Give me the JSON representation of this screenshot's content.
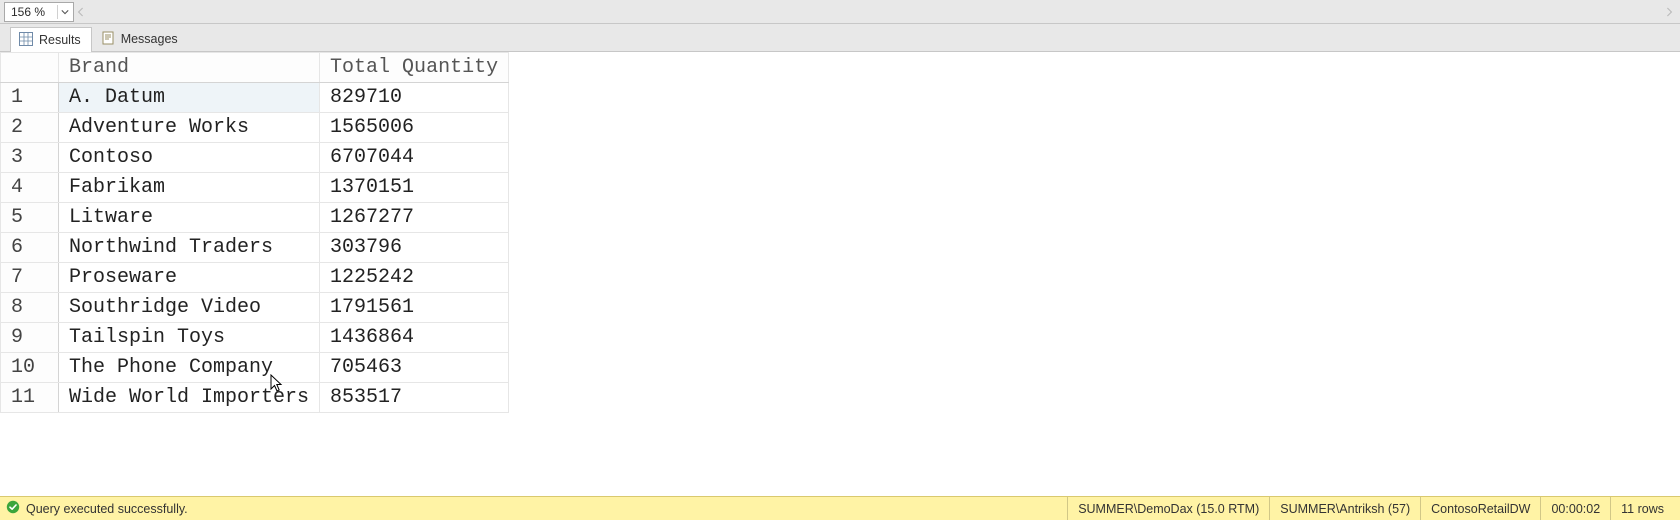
{
  "zoom": {
    "value": "156 %"
  },
  "tabs": {
    "results": "Results",
    "messages": "Messages"
  },
  "columns": {
    "c1": "Brand",
    "c2": "Total Quantity"
  },
  "rows": [
    {
      "n": "1",
      "brand": "A. Datum",
      "qty": "829710"
    },
    {
      "n": "2",
      "brand": "Adventure Works",
      "qty": "1565006"
    },
    {
      "n": "3",
      "brand": "Contoso",
      "qty": "6707044"
    },
    {
      "n": "4",
      "brand": "Fabrikam",
      "qty": "1370151"
    },
    {
      "n": "5",
      "brand": "Litware",
      "qty": "1267277"
    },
    {
      "n": "6",
      "brand": "Northwind Traders",
      "qty": "303796"
    },
    {
      "n": "7",
      "brand": "Proseware",
      "qty": "1225242"
    },
    {
      "n": "8",
      "brand": "Southridge Video",
      "qty": "1791561"
    },
    {
      "n": "9",
      "brand": "Tailspin Toys",
      "qty": "1436864"
    },
    {
      "n": "10",
      "brand": "The Phone Company",
      "qty": "705463"
    },
    {
      "n": "11",
      "brand": "Wide World Importers",
      "qty": "853517"
    }
  ],
  "status": {
    "message": "Query executed successfully.",
    "server": "SUMMER\\DemoDax (15.0 RTM)",
    "user": "SUMMER\\Antriksh (57)",
    "db": "ContosoRetailDW",
    "elapsed": "00:00:02",
    "rowcount": "11 rows"
  }
}
